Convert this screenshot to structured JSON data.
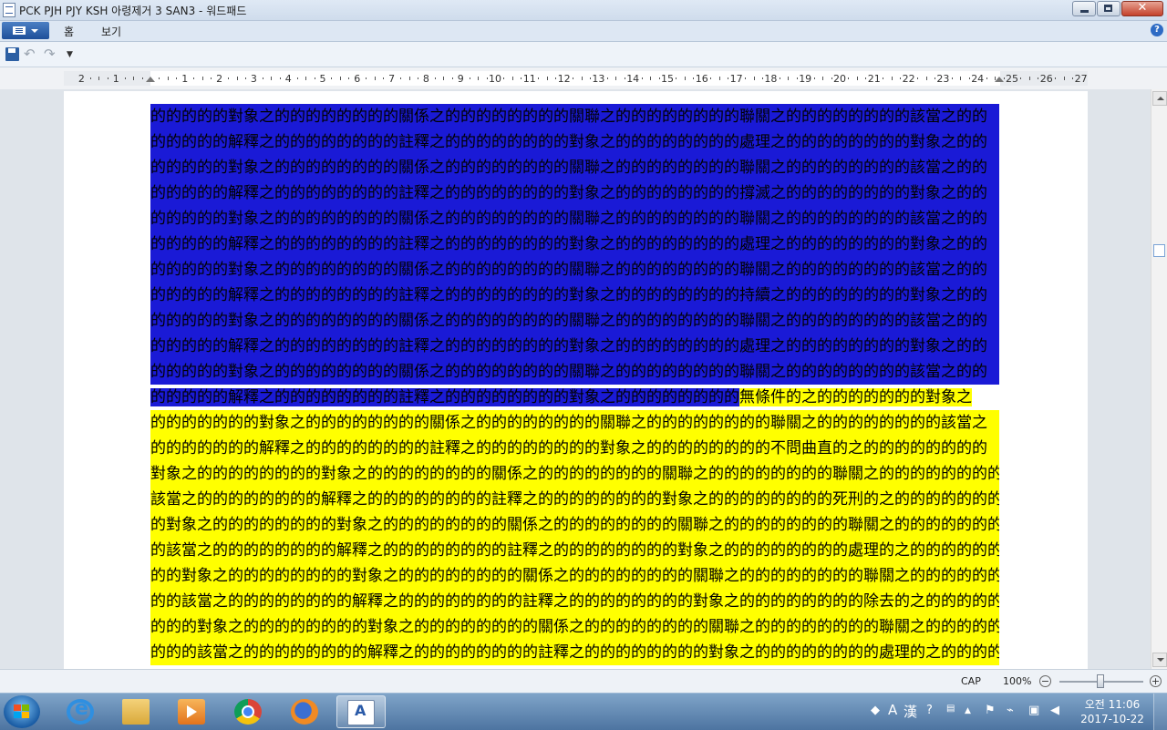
{
  "window": {
    "title": "PCK PJH PJY KSH 아령제거 3 SAN3 - 워드패드"
  },
  "ribbon": {
    "tabs": [
      "홈",
      "보기"
    ],
    "help_glyph": "?"
  },
  "qat": {
    "undo_glyph": "↶",
    "redo_glyph": "↷",
    "dropdown_glyph": "▼"
  },
  "ruler": {
    "labels": [
      "2",
      "1",
      "",
      "1",
      "2",
      "3",
      "4",
      "5",
      "6",
      "7",
      "8",
      "9",
      "10",
      "11",
      "12",
      "13",
      "14",
      "15",
      "16",
      "17",
      "18",
      "19",
      "20",
      "21",
      "22",
      "23",
      "24",
      "25",
      "26",
      "27"
    ]
  },
  "document": {
    "selected_lines": [
      "的的的的的對象之的的的的的的的的關係之的的的的的的的的關聯之的的的的的的的的聯關之的的的的的的的的該當之的的",
      "的的的的的解釋之的的的的的的的的註釋之的的的的的的的的對象之的的的的的的的的處理之的的的的的的的的對象之的的",
      "的的的的的對象之的的的的的的的的關係之的的的的的的的的關聯之的的的的的的的的聯關之的的的的的的的的該當之的的",
      "的的的的的解釋之的的的的的的的的註釋之的的的的的的的的對象之的的的的的的的的撐滅之的的的的的的的的對象之的的",
      "的的的的的對象之的的的的的的的的關係之的的的的的的的的關聯之的的的的的的的的聯關之的的的的的的的的該當之的的",
      "的的的的的解釋之的的的的的的的的註釋之的的的的的的的的對象之的的的的的的的的處理之的的的的的的的的對象之的的",
      "的的的的的對象之的的的的的的的的關係之的的的的的的的的關聯之的的的的的的的的聯關之的的的的的的的的該當之的的",
      "的的的的的解釋之的的的的的的的的註釋之的的的的的的的的對象之的的的的的的的的持續之的的的的的的的的對象之的的",
      "的的的的的對象之的的的的的的的的關係之的的的的的的的的關聯之的的的的的的的的聯關之的的的的的的的的該當之的的",
      "的的的的的解釋之的的的的的的的的註釋之的的的的的的的的對象之的的的的的的的的處理之的的的的的的的的對象之的的",
      "的的的的的對象之的的的的的的的的關係之的的的的的的的的關聯之的的的的的的的的聯關之的的的的的的的的該當之的的"
    ],
    "mixed_line": {
      "selected": "的的的的的解釋之的的的的的的的的註釋之的的的的的的的的對象之的的的的的的的的",
      "highlighted": "無條件的之的的的的的的的對象之"
    },
    "highlighted_lines": [
      "的的的的的的的對象之的的的的的的的的關係之的的的的的的的的關聯之的的的的的的的的聯關之的的的的的的的的該當之",
      "的的的的的的的解釋之的的的的的的的的註釋之的的的的的的的的對象之的的的的的的的的不問曲直的之的的的的的的的的",
      "對象之的的的的的的的的對象之的的的的的的的的關係之的的的的的的的的關聯之的的的的的的的的聯關之的的的的的的的的",
      "該當之的的的的的的的的解釋之的的的的的的的的註釋之的的的的的的的的對象之的的的的的的的的死刑的之的的的的的的的",
      "的對象之的的的的的的的的對象之的的的的的的的的關係之的的的的的的的的關聯之的的的的的的的的聯關之的的的的的的的",
      "的該當之的的的的的的的的解釋之的的的的的的的的註釋之的的的的的的的的對象之的的的的的的的的處理的之的的的的的的",
      "的的對象之的的的的的的的的對象之的的的的的的的的關係之的的的的的的的的關聯之的的的的的的的的聯關之的的的的的的",
      "的的該當之的的的的的的的的解釋之的的的的的的的的註釋之的的的的的的的的對象之的的的的的的的的除去的之的的的的的",
      "的的的對象之的的的的的的的的對象之的的的的的的的的關係之的的的的的的的的關聯之的的的的的的的的聯關之的的的的的",
      "的的的該當之的的的的的的的的解釋之的的的的的的的的註釋之的的的的的的的的對象之的的的的的的的的處理的之的的的的"
    ],
    "selection_color": "#1a1ad6",
    "highlight_color": "#ffff00"
  },
  "statusbar": {
    "caps": "CAP",
    "zoom": "100%",
    "zoom_out": "−",
    "zoom_in": "+"
  },
  "taskbar": {
    "apps": [
      "internet-explorer",
      "file-explorer",
      "media-player",
      "chrome",
      "firefox",
      "wordpad"
    ],
    "tray": {
      "ime_a": "A",
      "ime_hanja": "漢",
      "clock_period": "오전 11:06",
      "date": "2017-10-22"
    }
  }
}
